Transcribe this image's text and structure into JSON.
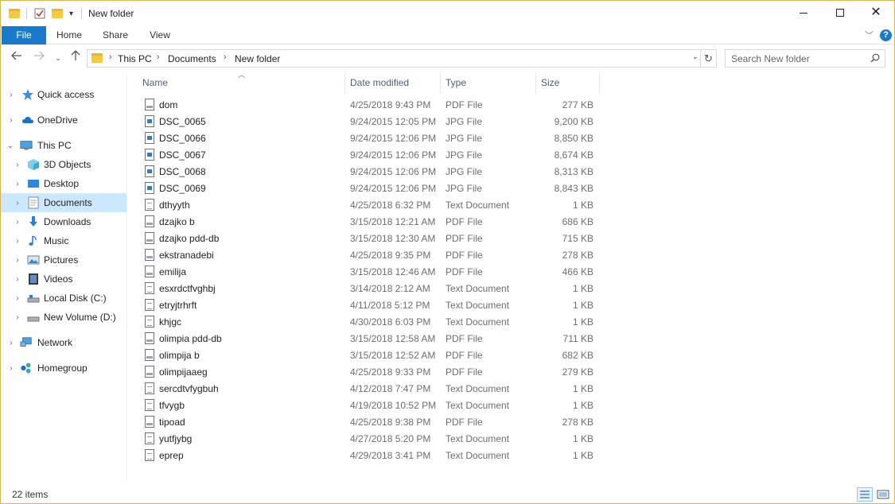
{
  "window": {
    "title": "New folder"
  },
  "ribbon": {
    "tabs": [
      "File",
      "Home",
      "Share",
      "View"
    ],
    "help_label": "?"
  },
  "address": {
    "crumbs": [
      "This PC",
      "Documents",
      "New folder"
    ]
  },
  "search": {
    "placeholder": "Search New folder"
  },
  "sidebar": {
    "items": [
      {
        "label": "Quick access",
        "icon": "star-icon",
        "level": 0,
        "selected": false
      },
      {
        "label": "OneDrive",
        "icon": "cloud-icon",
        "level": 0,
        "selected": false
      },
      {
        "label": "This PC",
        "icon": "computer-icon",
        "level": 0,
        "expanded": true,
        "selected": false
      },
      {
        "label": "3D Objects",
        "icon": "cube-icon",
        "level": 1,
        "selected": false
      },
      {
        "label": "Desktop",
        "icon": "desktop-icon",
        "level": 1,
        "selected": false
      },
      {
        "label": "Documents",
        "icon": "documents-icon",
        "level": 1,
        "selected": true
      },
      {
        "label": "Downloads",
        "icon": "download-icon",
        "level": 1,
        "selected": false
      },
      {
        "label": "Music",
        "icon": "music-icon",
        "level": 1,
        "selected": false
      },
      {
        "label": "Pictures",
        "icon": "pictures-icon",
        "level": 1,
        "selected": false
      },
      {
        "label": "Videos",
        "icon": "videos-icon",
        "level": 1,
        "selected": false
      },
      {
        "label": "Local Disk (C:)",
        "icon": "disk-icon",
        "level": 1,
        "selected": false
      },
      {
        "label": "New Volume (D:)",
        "icon": "drive-icon",
        "level": 1,
        "selected": false
      },
      {
        "label": "Network",
        "icon": "network-icon",
        "level": 0,
        "selected": false
      },
      {
        "label": "Homegroup",
        "icon": "homegroup-icon",
        "level": 0,
        "selected": false
      }
    ]
  },
  "columns": {
    "name": "Name",
    "date": "Date modified",
    "type": "Type",
    "size": "Size"
  },
  "files": [
    {
      "name": "dom",
      "date": "4/25/2018 9:43 PM",
      "type": "PDF File",
      "size": "277 KB",
      "kind": "pdf"
    },
    {
      "name": "DSC_0065",
      "date": "9/24/2015 12:05 PM",
      "type": "JPG File",
      "size": "9,200 KB",
      "kind": "jpg"
    },
    {
      "name": "DSC_0066",
      "date": "9/24/2015 12:06 PM",
      "type": "JPG File",
      "size": "8,850 KB",
      "kind": "jpg"
    },
    {
      "name": "DSC_0067",
      "date": "9/24/2015 12:06 PM",
      "type": "JPG File",
      "size": "8,674 KB",
      "kind": "jpg"
    },
    {
      "name": "DSC_0068",
      "date": "9/24/2015 12:06 PM",
      "type": "JPG File",
      "size": "8,313 KB",
      "kind": "jpg"
    },
    {
      "name": "DSC_0069",
      "date": "9/24/2015 12:06 PM",
      "type": "JPG File",
      "size": "8,843 KB",
      "kind": "jpg"
    },
    {
      "name": "dthyyth",
      "date": "4/25/2018 6:32 PM",
      "type": "Text Document",
      "size": "1 KB",
      "kind": "txt"
    },
    {
      "name": "dzajko b",
      "date": "3/15/2018 12:21 AM",
      "type": "PDF File",
      "size": "686 KB",
      "kind": "pdf"
    },
    {
      "name": "dzajko pdd-db",
      "date": "3/15/2018 12:30 AM",
      "type": "PDF File",
      "size": "715 KB",
      "kind": "pdf"
    },
    {
      "name": "ekstranadebi",
      "date": "4/25/2018 9:35 PM",
      "type": "PDF File",
      "size": "278 KB",
      "kind": "pdf"
    },
    {
      "name": "emilija",
      "date": "3/15/2018 12:46 AM",
      "type": "PDF File",
      "size": "466 KB",
      "kind": "pdf"
    },
    {
      "name": "esxrdctfvghbj",
      "date": "3/14/2018 2:12 AM",
      "type": "Text Document",
      "size": "1 KB",
      "kind": "txt"
    },
    {
      "name": "etryjtrhrft",
      "date": "4/11/2018 5:12 PM",
      "type": "Text Document",
      "size": "1 KB",
      "kind": "txt"
    },
    {
      "name": "khjgc",
      "date": "4/30/2018 6:03 PM",
      "type": "Text Document",
      "size": "1 KB",
      "kind": "txt"
    },
    {
      "name": "olimpia pdd-db",
      "date": "3/15/2018 12:58 AM",
      "type": "PDF File",
      "size": "711 KB",
      "kind": "pdf"
    },
    {
      "name": "olimpija b",
      "date": "3/15/2018 12:52 AM",
      "type": "PDF File",
      "size": "682 KB",
      "kind": "pdf"
    },
    {
      "name": "olimpijaaeg",
      "date": "4/25/2018 9:33 PM",
      "type": "PDF File",
      "size": "279 KB",
      "kind": "pdf"
    },
    {
      "name": "sercdtvfygbuh",
      "date": "4/12/2018 7:47 PM",
      "type": "Text Document",
      "size": "1 KB",
      "kind": "txt"
    },
    {
      "name": "tfvygb",
      "date": "4/19/2018 10:52 PM",
      "type": "Text Document",
      "size": "1 KB",
      "kind": "txt"
    },
    {
      "name": "tipoad",
      "date": "4/25/2018 9:38 PM",
      "type": "PDF File",
      "size": "278 KB",
      "kind": "pdf"
    },
    {
      "name": "yutfjybg",
      "date": "4/27/2018 5:20 PM",
      "type": "Text Document",
      "size": "1 KB",
      "kind": "txt"
    },
    {
      "name": "eprep",
      "date": "4/29/2018 3:41 PM",
      "type": "Text Document",
      "size": "1 KB",
      "kind": "txt"
    }
  ],
  "status": {
    "count": "22 items"
  },
  "colors": {
    "accent": "#1979ca",
    "selection": "#cce8ff",
    "folder": "#f5c941"
  }
}
